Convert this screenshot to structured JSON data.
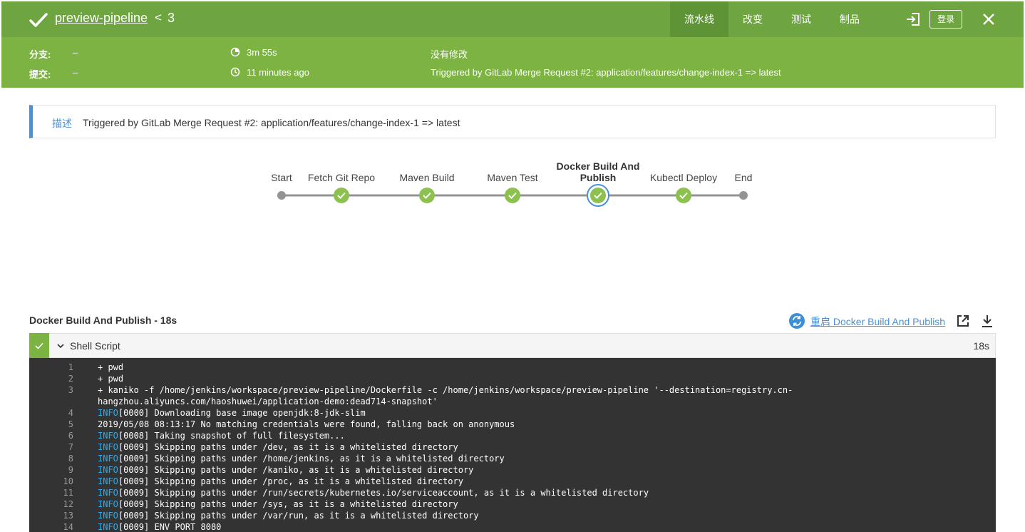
{
  "header": {
    "pipeline_name": "preview-pipeline",
    "run_separator": "<",
    "run_number": "3",
    "nav": [
      {
        "label": "流水线",
        "active": true
      },
      {
        "label": "改变",
        "active": false
      },
      {
        "label": "测试",
        "active": false
      },
      {
        "label": "制品",
        "active": false
      }
    ],
    "login_label": "登录"
  },
  "run_meta": {
    "branch_label": "分支:",
    "branch_value": "–",
    "commit_label": "提交:",
    "commit_value": "–",
    "duration": "3m 55s",
    "started": "11 minutes ago",
    "changes": "没有修改",
    "cause": "Triggered by GitLab Merge Request #2: application/features/change-index-1 => latest"
  },
  "description": {
    "label": "描述",
    "text": "Triggered by GitLab Merge Request #2: application/features/change-index-1 => latest"
  },
  "pipeline": {
    "stages": [
      {
        "name": "Start",
        "lines": [
          "Start"
        ],
        "status": "start"
      },
      {
        "name": "Fetch Git Repo",
        "lines": [
          "Fetch Git Repo"
        ],
        "status": "success"
      },
      {
        "name": "Maven Build",
        "lines": [
          "Maven Build"
        ],
        "status": "success"
      },
      {
        "name": "Maven Test",
        "lines": [
          "Maven Test"
        ],
        "status": "success"
      },
      {
        "name": "Docker Build And Publish",
        "lines": [
          "Docker Build And",
          "Publish"
        ],
        "status": "success",
        "selected": true
      },
      {
        "name": "Kubectl Deploy",
        "lines": [
          "Kubectl Deploy"
        ],
        "status": "success"
      },
      {
        "name": "End",
        "lines": [
          "End"
        ],
        "status": "end"
      }
    ]
  },
  "step_detail": {
    "title": "Docker Build And Publish - 18s",
    "restart_label": "重启 Docker Build And Publish",
    "step_name": "Shell Script",
    "step_duration": "18s"
  },
  "log": {
    "lines": [
      {
        "num": "1",
        "prefix": "",
        "text": "+ pwd"
      },
      {
        "num": "2",
        "prefix": "",
        "text": "+ pwd"
      },
      {
        "num": "3",
        "prefix": "",
        "text": "+ kaniko -f /home/jenkins/workspace/preview-pipeline/Dockerfile -c /home/jenkins/workspace/preview-pipeline '--destination=registry.cn-hangzhou.aliyuncs.com/haoshuwei/application-demo:dead714-snapshot'"
      },
      {
        "num": "4",
        "prefix": "INFO",
        "text": "[0000] Downloading base image openjdk:8-jdk-slim"
      },
      {
        "num": "5",
        "prefix": "",
        "text": "2019/05/08 08:13:17 No matching credentials were found, falling back on anonymous"
      },
      {
        "num": "6",
        "prefix": "INFO",
        "text": "[0008] Taking snapshot of full filesystem..."
      },
      {
        "num": "7",
        "prefix": "INFO",
        "text": "[0009] Skipping paths under /dev, as it is a whitelisted directory"
      },
      {
        "num": "8",
        "prefix": "INFO",
        "text": "[0009] Skipping paths under /home/jenkins, as it is a whitelisted directory"
      },
      {
        "num": "9",
        "prefix": "INFO",
        "text": "[0009] Skipping paths under /kaniko, as it is a whitelisted directory"
      },
      {
        "num": "10",
        "prefix": "INFO",
        "text": "[0009] Skipping paths under /proc, as it is a whitelisted directory"
      },
      {
        "num": "11",
        "prefix": "INFO",
        "text": "[0009] Skipping paths under /run/secrets/kubernetes.io/serviceaccount, as it is a whitelisted directory"
      },
      {
        "num": "12",
        "prefix": "INFO",
        "text": "[0009] Skipping paths under /sys, as it is a whitelisted directory"
      },
      {
        "num": "13",
        "prefix": "INFO",
        "text": "[0009] Skipping paths under /var/run, as it is a whitelisted directory"
      },
      {
        "num": "14",
        "prefix": "INFO",
        "text": "[0009] ENV PORT 8080"
      }
    ]
  },
  "colors": {
    "header_bg": "#6ea540",
    "subheader_bg": "#7cb342",
    "success": "#8cc04f",
    "selected_ring": "#4a90d9",
    "link": "#4a90d9",
    "log_bg": "#333333",
    "log_info": "#3aa7e0"
  },
  "icons": {
    "status": "check-icon",
    "duration": "pie-clock-icon",
    "started": "clock-icon",
    "exit": "exit-icon",
    "close": "close-icon",
    "restart": "refresh-icon",
    "open": "external-link-icon",
    "download": "download-icon",
    "expand": "chevron-down-icon"
  }
}
